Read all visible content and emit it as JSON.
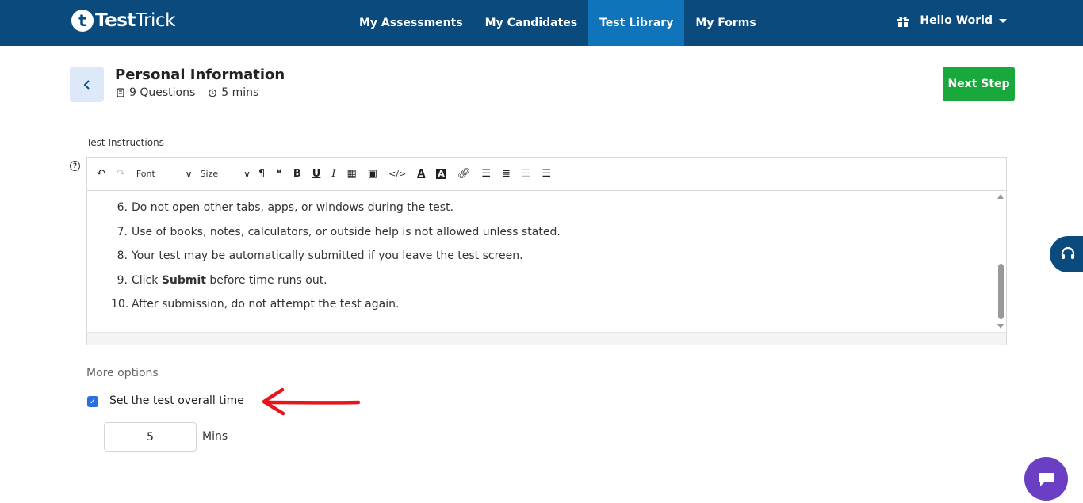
{
  "brand": {
    "logo_letter": "t",
    "name_bold": "Test",
    "name_light": "Trick"
  },
  "nav": {
    "items": [
      {
        "label": "My Assessments",
        "active": false
      },
      {
        "label": "My Candidates",
        "active": false
      },
      {
        "label": "Test Library",
        "active": true
      },
      {
        "label": "My Forms",
        "active": false
      }
    ],
    "user_label": "Hello World"
  },
  "page": {
    "title": "Personal Information",
    "questions": "9 Questions",
    "duration": "5 mins",
    "next_label": "Next Step"
  },
  "editor": {
    "label": "Test Instructions",
    "font_label": "Font",
    "size_label": "Size",
    "lines": [
      {
        "num": "6.",
        "pre": "Do not open other tabs, apps, or windows during the test.",
        "bold": "",
        "post": ""
      },
      {
        "num": "7.",
        "pre": "Use of books, notes, calculators, or outside help is not allowed unless stated.",
        "bold": "",
        "post": ""
      },
      {
        "num": "8.",
        "pre": "Your test may be automatically submitted if you leave the test screen.",
        "bold": "",
        "post": ""
      },
      {
        "num": "9.",
        "pre": "Click ",
        "bold": "Submit",
        "post": " before time runs out."
      },
      {
        "num": "10.",
        "pre": "After submission, do not attempt the test again.",
        "bold": "",
        "post": ""
      }
    ]
  },
  "options": {
    "heading": "More options",
    "overall_time_label": "Set the test overall time",
    "overall_time_checked": true,
    "time_value": "5",
    "time_unit": "Mins"
  },
  "colors": {
    "nav_bg": "#0a4a7d",
    "nav_active": "#0f74b9",
    "next_button": "#18a83c",
    "checkbox": "#2a6fe0",
    "annotation_arrow": "#e8141b",
    "chat_button": "#6a3fc4"
  }
}
